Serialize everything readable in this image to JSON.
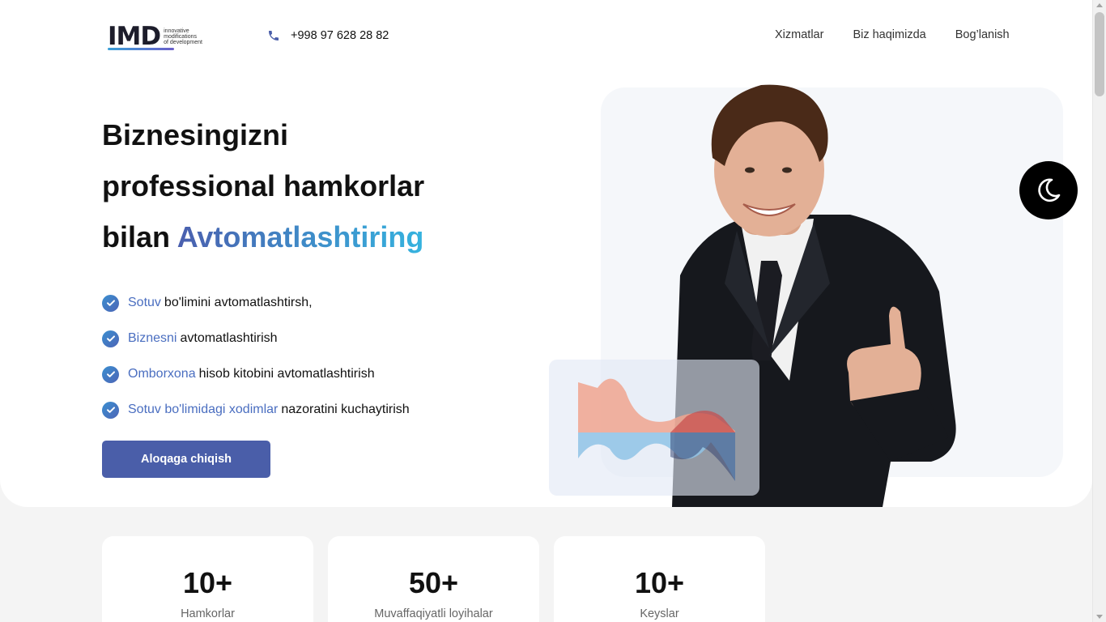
{
  "header": {
    "logo_mark": "IMD",
    "logo_tagline": [
      "innovative",
      "modifications",
      "of development"
    ],
    "phone": "+998 97 628 28 82",
    "nav": [
      "Xizmatlar",
      "Biz haqimizda",
      "Bog’lanish"
    ]
  },
  "hero": {
    "headline_line1": "Biznesingizni",
    "headline_line2": "professional hamkorlar",
    "headline_line3_prefix": "bilan",
    "headline_accent": "Avtomatlashtiring",
    "features": [
      {
        "highlight": "Sotuv",
        "text": "bo'limini avtomatlashtirsh,"
      },
      {
        "highlight": "Biznesni",
        "text": "avtomatlashtirish"
      },
      {
        "highlight": "Omborxona",
        "text": "hisob kitobini avtomatlashtirish"
      },
      {
        "highlight": "Sotuv bo'limidagi xodimlar",
        "text": "nazoratini kuchaytirish"
      }
    ],
    "cta_label": "Aloqaga chiqish"
  },
  "stats": [
    {
      "value": "10+",
      "label": "Hamkorlar"
    },
    {
      "value": "50+",
      "label": "Muvaffaqiyatli loyihalar"
    },
    {
      "value": "10+",
      "label": "Keyslar"
    }
  ],
  "colors": {
    "brand": "#4a5ea9",
    "accent_start": "#4a5fae",
    "accent_end": "#35b3df",
    "feature_highlight": "#4a6ec0"
  },
  "icons": {
    "phone": "phone-icon",
    "check": "check-circle-icon",
    "theme_toggle": "moon-icon"
  }
}
